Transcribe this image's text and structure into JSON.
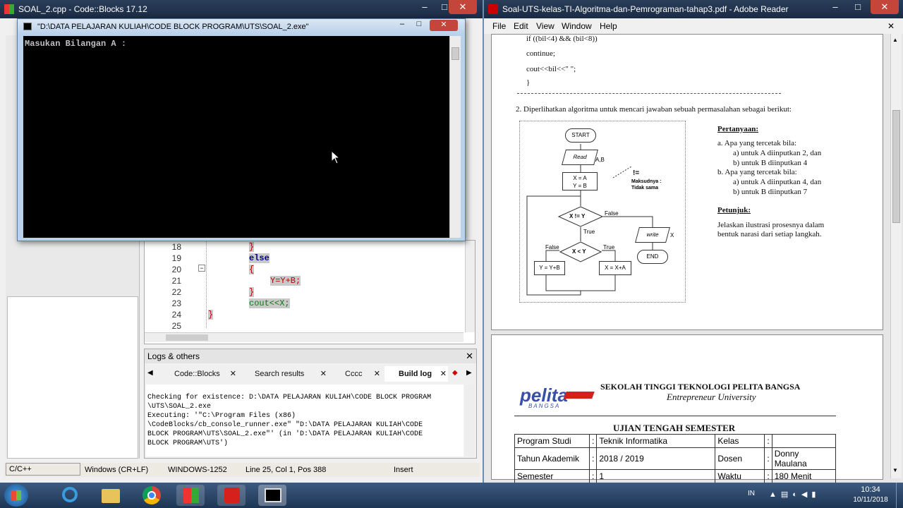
{
  "codeblocks": {
    "title": "SOAL_2.cpp - Code::Blocks 17.12",
    "editor_lines": [
      {
        "num": "18",
        "code": "}"
      },
      {
        "num": "19",
        "code": "else"
      },
      {
        "num": "20",
        "code": "{"
      },
      {
        "num": "21",
        "code": "Y=Y+B;"
      },
      {
        "num": "22",
        "code": "}"
      },
      {
        "num": "23",
        "code": "cout<<X;"
      },
      {
        "num": "24",
        "code": "}"
      },
      {
        "num": "25",
        "code": ""
      }
    ],
    "logs_title": "Logs & others",
    "tabs": [
      "Code::Blocks",
      "Search results",
      "Cccc",
      "Build log"
    ],
    "log_lines": [
      "Checking for existence: D:\\DATA PELAJARAN KULIAH\\CODE BLOCK PROGRAM",
      "\\UTS\\SOAL_2.exe",
      "Executing: '\"C:\\Program Files (x86)",
      "\\CodeBlocks/cb_console_runner.exe\" \"D:\\DATA PELAJARAN KULIAH\\CODE",
      "BLOCK PROGRAM\\UTS\\SOAL_2.exe\"' (in 'D:\\DATA PELAJARAN KULIAH\\CODE",
      "BLOCK PROGRAM\\UTS')"
    ],
    "status": {
      "lang": "C/C++",
      "eol": "Windows (CR+LF)",
      "encoding": "WINDOWS-1252",
      "pos": "Line 25, Col 1, Pos 388",
      "mode": "Insert"
    }
  },
  "console": {
    "title": "\"D:\\DATA PELAJARAN KULIAH\\CODE BLOCK PROGRAM\\UTS\\SOAL_2.exe\"",
    "output": "Masukan Bilangan A :"
  },
  "reader": {
    "title": "Soal-UTS-kelas-TI-Algoritma-dan-Pemrograman-tahap3.pdf - Adobe Reader",
    "menu": [
      "File",
      "Edit",
      "View",
      "Window",
      "Help"
    ],
    "code_lines": [
      "if ((bil<4) && (bil<8))",
      "continue;",
      "cout<<bil<<\" \";",
      "}"
    ],
    "question2": "2. Diperlihatkan algoritma untuk mencari jawaban sebuah permasalahan sebagai berikut:",
    "flow": {
      "start": "START",
      "read": "Read",
      "read_vars": "A,B",
      "assign1": "X = A",
      "assign2": "Y = B",
      "neq": "!=",
      "neq_note1": "Maksudnya :",
      "neq_note2": "Tidak sama",
      "cond1": "X != Y",
      "false": "False",
      "true": "True",
      "write": "write",
      "write_var": "X",
      "end": "END",
      "cond2": "X < Y",
      "false2": "False",
      "true2": "True",
      "box_left": "Y = Y+B",
      "box_right": "X = X+A"
    },
    "pertanyaan_title": "Pertanyaan:",
    "pertanyaan": [
      "a.    Apa yang tercetak bila:",
      "a)    untuk A diinputkan  2,  dan",
      "b)    untuk B diinputkan  4",
      "b.    Apa yang tercetak bila:",
      "a)    untuk A diinputkan  4,  dan",
      "b)    untuk B diinputkan  7"
    ],
    "petunjuk_title": "Petunjuk:",
    "petunjuk": [
      "Jelaskan ilustrasi prosesnya dalam",
      "bentuk narasi dari setiap langkah."
    ],
    "logo": "pelita",
    "logo_sub": "BANGSA",
    "school": "SEKOLAH TINGGI TEKNOLOGI PELITA BANGSA",
    "school_sub": "Entrepreneur University",
    "exam_title": "UJIAN TENGAH SEMESTER",
    "table": [
      [
        "Program Studi",
        ":",
        "Teknik Informatika",
        "Kelas",
        ":",
        ""
      ],
      [
        "Tahun Akademik",
        ":",
        "2018 / 2019",
        "Dosen",
        ":",
        "Donny Maulana"
      ],
      [
        "Semester",
        ":",
        "1",
        "Waktu",
        ":",
        "180 Menit"
      ]
    ]
  },
  "taskbar": {
    "lang": "IN",
    "time": "10:34",
    "date": "10/11/2018"
  },
  "colors": {
    "accent_pdf": "#d5201c",
    "console_bg": "#000000",
    "taskbar": "#1d3554"
  }
}
